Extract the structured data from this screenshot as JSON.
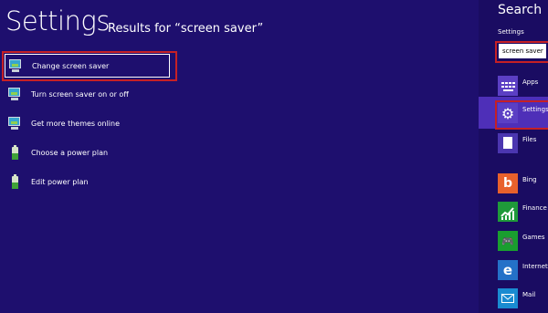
{
  "page": {
    "title": "Settings",
    "results_caption": "Results for “screen saver”"
  },
  "results": [
    {
      "label": "Change screen saver",
      "icon": "screen-saver-icon",
      "selected": true
    },
    {
      "label": "Turn screen saver on or off",
      "icon": "screen-saver-icon"
    },
    {
      "label": "Get more themes online",
      "icon": "screen-saver-icon"
    },
    {
      "label": "Choose a power plan",
      "icon": "battery-icon"
    },
    {
      "label": "Edit power plan",
      "icon": "battery-icon"
    }
  ],
  "charm": {
    "title": "Search",
    "scope_label": "Settings",
    "search_value": "screen saver",
    "items": [
      {
        "label": "Apps",
        "icon": "keyboard-icon"
      },
      {
        "label": "Settings",
        "icon": "gear-icon",
        "active": true
      },
      {
        "label": "Files",
        "icon": "document-icon"
      },
      {
        "label": "Bing",
        "icon": "bing-icon"
      },
      {
        "label": "Finance",
        "icon": "finance-icon"
      },
      {
        "label": "Games",
        "icon": "games-icon"
      },
      {
        "label": "Internet",
        "icon": "internet-explorer-icon"
      },
      {
        "label": "Mail",
        "icon": "mail-icon"
      }
    ]
  },
  "colors": {
    "background": "#1e0f6e",
    "highlight": "#c62025",
    "active_item": "#4e2fb8"
  }
}
